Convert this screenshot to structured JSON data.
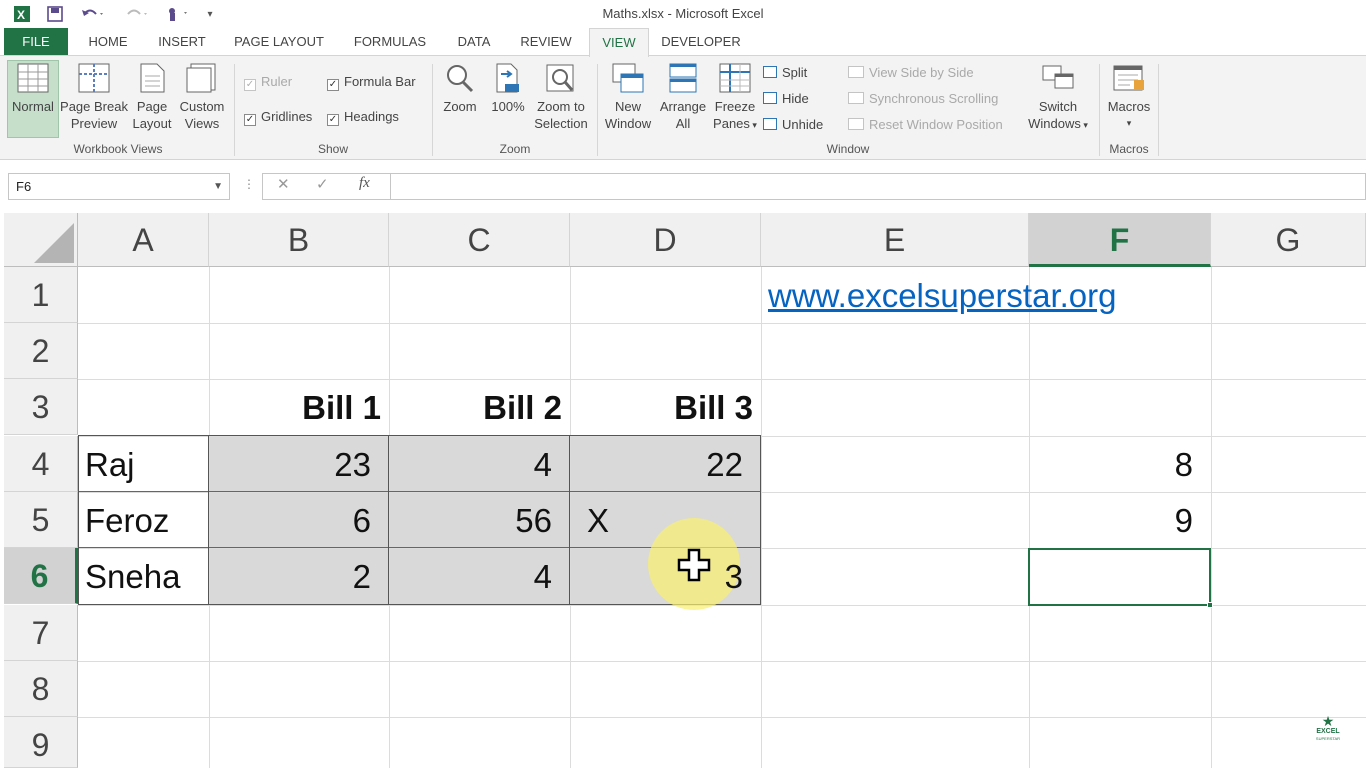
{
  "window": {
    "title": "Maths.xlsx - Microsoft Excel"
  },
  "quick_access": {
    "excel_icon": "excel-logo-icon",
    "save_icon": "save-icon",
    "undo_icon": "undo-icon",
    "redo_icon": "redo-icon",
    "touch_icon": "touch-mode-icon",
    "customize_icon": "customize-icon"
  },
  "tabs": [
    "FILE",
    "HOME",
    "INSERT",
    "PAGE LAYOUT",
    "FORMULAS",
    "DATA",
    "REVIEW",
    "VIEW",
    "DEVELOPER"
  ],
  "active_tab": "VIEW",
  "ribbon": {
    "workbook_views": {
      "label": "Workbook Views",
      "normal": "Normal",
      "page_break": [
        "Page Break",
        "Preview"
      ],
      "page_layout": [
        "Page",
        "Layout"
      ],
      "custom_views": [
        "Custom",
        "Views"
      ]
    },
    "show": {
      "label": "Show",
      "ruler": "Ruler",
      "formula_bar": "Formula Bar",
      "gridlines": "Gridlines",
      "headings": "Headings",
      "ruler_checked": true,
      "formula_bar_checked": true,
      "gridlines_checked": true,
      "headings_checked": true
    },
    "zoom": {
      "label": "Zoom",
      "zoom": "Zoom",
      "hundred": "100%",
      "zoom_to_selection": [
        "Zoom to",
        "Selection"
      ],
      "badge": "100"
    },
    "window": {
      "label": "Window",
      "new_window": [
        "New",
        "Window"
      ],
      "arrange_all": [
        "Arrange",
        "All"
      ],
      "freeze_panes": [
        "Freeze",
        "Panes"
      ],
      "split": "Split",
      "hide": "Hide",
      "unhide": "Unhide",
      "view_side_by_side": "View Side by Side",
      "sync_scrolling": "Synchronous Scrolling",
      "reset_position": "Reset Window Position",
      "switch_windows": [
        "Switch",
        "Windows"
      ]
    },
    "macros": {
      "label": "Macros",
      "macros": "Macros"
    }
  },
  "formula_bar": {
    "name_box": "F6",
    "cancel": "✕",
    "enter": "✓",
    "fx": "fx",
    "content": ""
  },
  "columns": [
    "A",
    "B",
    "C",
    "D",
    "E",
    "F",
    "G"
  ],
  "selected_column": "F",
  "rows": [
    "1",
    "2",
    "3",
    "4",
    "5",
    "6",
    "7",
    "8",
    "9"
  ],
  "selected_row": "6",
  "cells": {
    "E1": "www.excelsuperstar.org",
    "B3": "Bill 1",
    "C3": "Bill 2",
    "D3": "Bill 3",
    "A4": "Raj",
    "B4": "23",
    "C4": "4",
    "D4": "22",
    "F4": "8",
    "A5": "Feroz",
    "B5": "6",
    "C5": "56",
    "D5": "X",
    "F5": "9",
    "A6": "Sneha",
    "B6": "2",
    "C6": "4",
    "D6": "3"
  },
  "active_cell": "F6",
  "watermark": {
    "text": "EXCEL",
    "sub": "SUPERSTAR"
  },
  "colors": {
    "accent": "#217346",
    "link": "#0563c1",
    "shade": "#d9d9d9",
    "cursor_halo": "#f7ef6e"
  }
}
